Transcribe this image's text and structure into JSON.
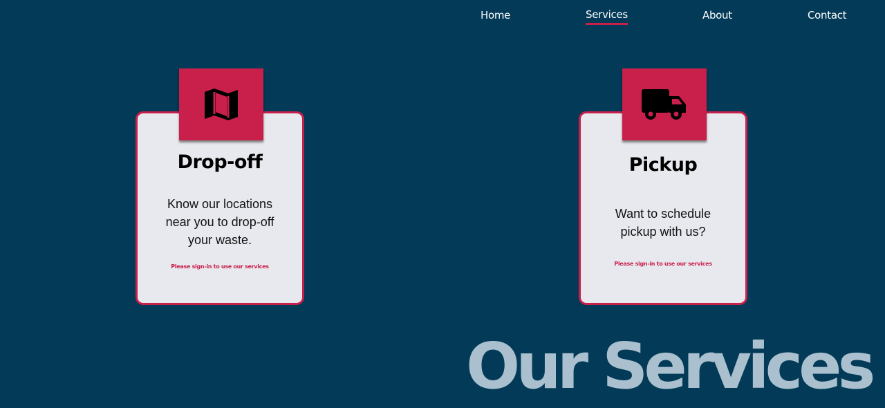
{
  "nav": {
    "items": [
      {
        "label": "Home"
      },
      {
        "label": "Services"
      },
      {
        "label": "About"
      },
      {
        "label": "Contact"
      }
    ],
    "active": "Services"
  },
  "cards": [
    {
      "title": "Drop-off",
      "icon": "map-icon",
      "description": "Know our locations near you to drop-off your waste.",
      "note": "Please sign-in to use our services"
    },
    {
      "title": "Pickup",
      "icon": "truck-icon",
      "description": "Want to schedule pickup with us?",
      "note": "Please sign-in to use our services"
    }
  ],
  "section_title": "Our Services",
  "colors": {
    "background": "#033a57",
    "accent": "#c9204b",
    "card": "#e8e9ef",
    "title_faded": "#aac0cf"
  }
}
